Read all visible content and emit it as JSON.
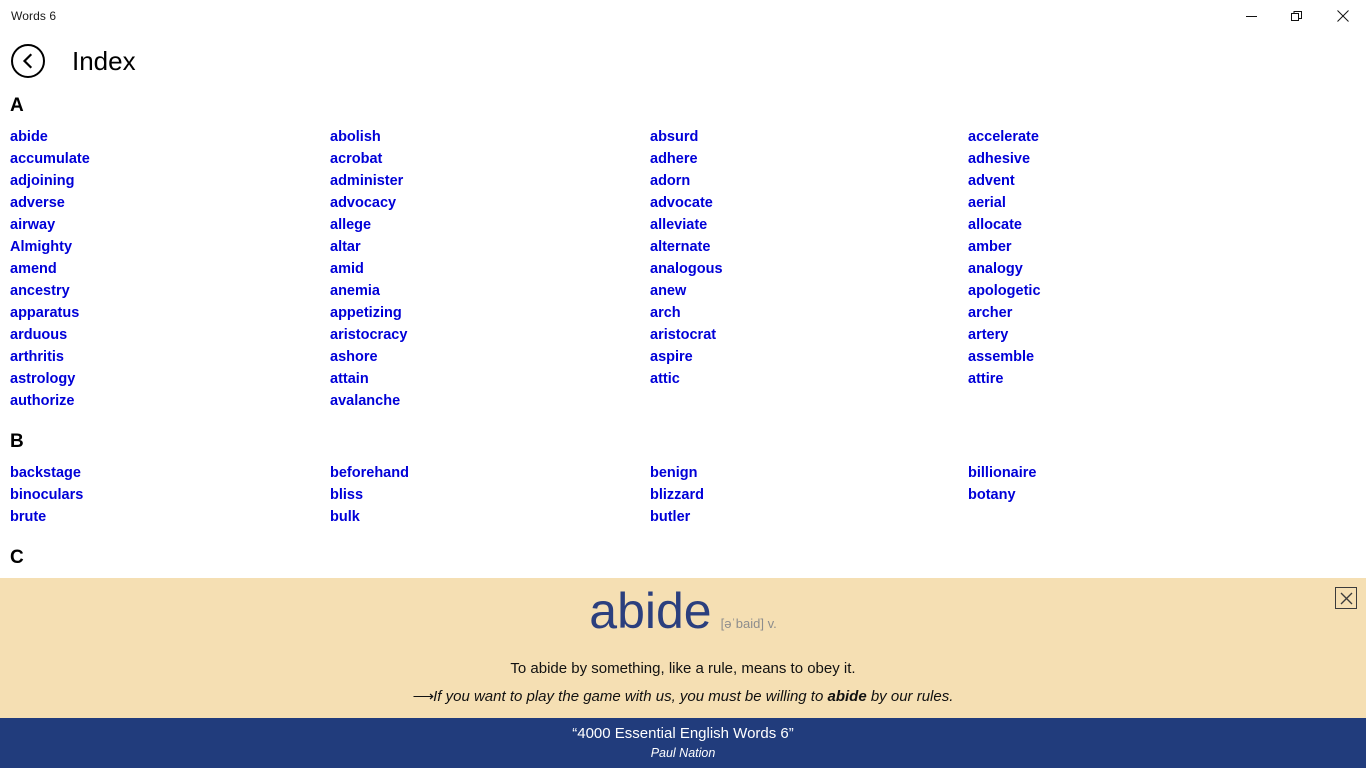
{
  "window": {
    "title": "Words 6",
    "controls": [
      {
        "name": "minimize",
        "label": "—"
      },
      {
        "name": "maximize",
        "label": "❐"
      },
      {
        "name": "close",
        "label": "✕"
      }
    ]
  },
  "header": {
    "back_icon": "chevron-left-icon",
    "title": "Index"
  },
  "index": {
    "sections": [
      {
        "letter": "A",
        "columns": [
          [
            "abide",
            "accumulate",
            "adjoining",
            "adverse",
            "airway",
            "Almighty",
            "amend",
            "ancestry",
            "apparatus",
            "arduous",
            "arthritis",
            "astrology",
            "authorize"
          ],
          [
            "abolish",
            "acrobat",
            "administer",
            "advocacy",
            "allege",
            "altar",
            "amid",
            "anemia",
            "appetizing",
            "aristocracy",
            "ashore",
            "attain",
            "avalanche"
          ],
          [
            "absurd",
            "adhere",
            "adorn",
            "advocate",
            "alleviate",
            "alternate",
            "analogous",
            "anew",
            "arch",
            "aristocrat",
            "aspire",
            "attic"
          ],
          [
            "accelerate",
            "adhesive",
            "advent",
            "aerial",
            "allocate",
            "amber",
            "analogy",
            "apologetic",
            "archer",
            "artery",
            "assemble",
            "attire"
          ]
        ]
      },
      {
        "letter": "B",
        "columns": [
          [
            "backstage",
            "binoculars",
            "brute"
          ],
          [
            "beforehand",
            "bliss",
            "bulk"
          ],
          [
            "benign",
            "blizzard",
            "butler"
          ],
          [
            "billionaire",
            "botany"
          ]
        ]
      },
      {
        "letter": "C",
        "columns": [
          [],
          [],
          [],
          []
        ]
      }
    ]
  },
  "definition_panel": {
    "close_icon": "close-icon",
    "headword": "abide",
    "phonetic": "[əˈbaid] v.",
    "definition": "To abide by something, like a rule, means to obey it.",
    "example_arrow": "⟶",
    "example_prefix": "If you want to play the game with us, you must be willing to ",
    "example_bold": "abide",
    "example_suffix": " by our rules.",
    "background_color": "#F5DFB3",
    "headword_color": "#2B3F7E"
  },
  "footer": {
    "title": "“4000 Essential English Words 6”",
    "author": "Paul Nation",
    "background_color": "#213C7C"
  },
  "theme": {
    "link_color": "#0000D8",
    "page_background": "#FFFFFF"
  }
}
